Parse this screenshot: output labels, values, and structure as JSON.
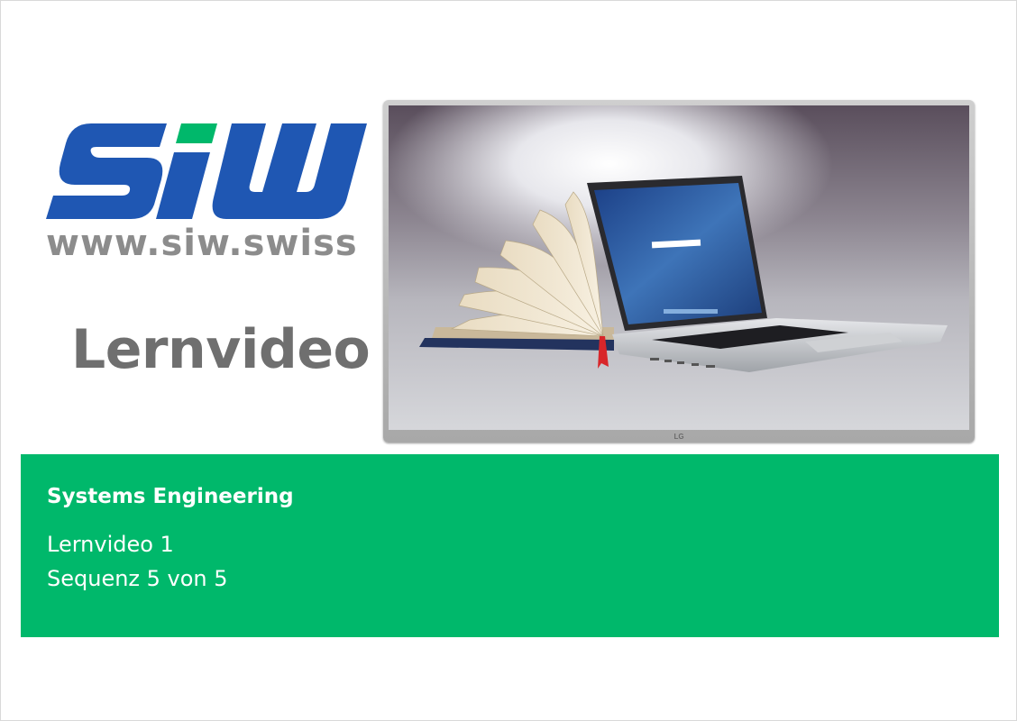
{
  "logo": {
    "wordmark": "SIW",
    "url": "www.siw.swiss",
    "brand_color": "#1f57b3",
    "url_color": "#8c8c8c"
  },
  "title": "Lernvideo",
  "tv": {
    "brand": "LG",
    "screen_description_icon": "book-laptop-image"
  },
  "band": {
    "color": "#00b86b",
    "heading": "Systems Engineering",
    "line1": "Lernvideo 1",
    "line2": "Sequenz 5 von 5"
  }
}
